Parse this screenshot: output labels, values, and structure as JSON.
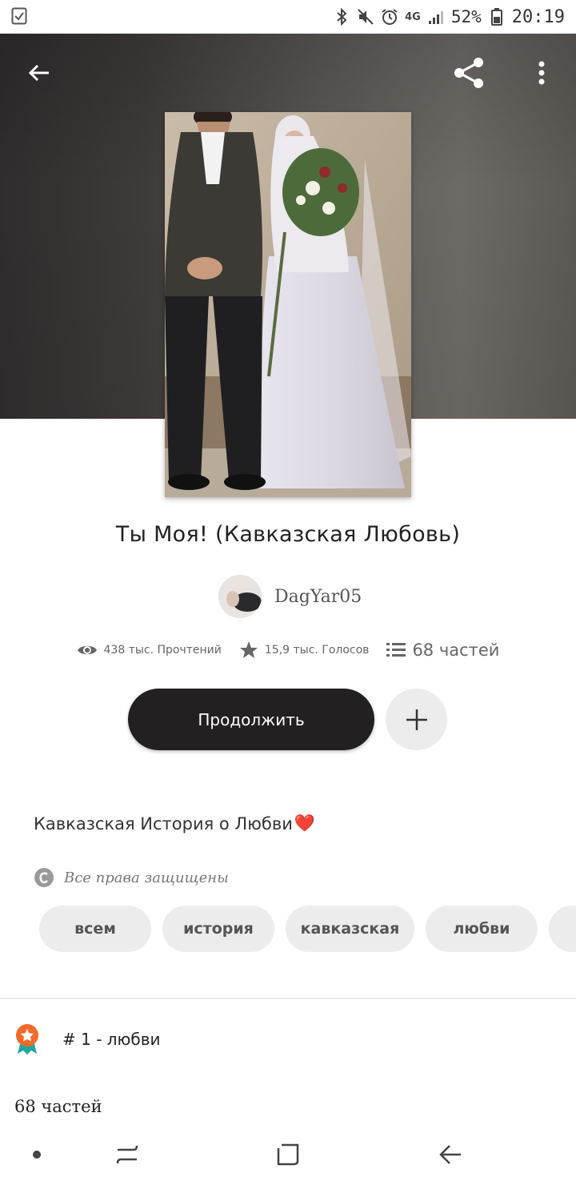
{
  "status_bar": {
    "network": "4G",
    "battery": "52%",
    "time": "20:19"
  },
  "story": {
    "title": "Ты Моя! (Кавказская Любовь)",
    "author": "DagYar05",
    "description": "Кавказская История о Любви",
    "description_emoji": "❤️",
    "rights": "Все права защищены"
  },
  "stats": {
    "reads": "438 тыс. Прочтений",
    "votes": "15,9 тыс. Голосов",
    "parts": "68 частей"
  },
  "actions": {
    "continue_label": "Продолжить"
  },
  "tags": [
    "всем",
    "история",
    "кавказская",
    "любви"
  ],
  "rank": {
    "text": "# 1 - любви"
  },
  "parts_label": "68 частей",
  "colors": {
    "primary_button": "#222021",
    "chip_bg": "#ececec",
    "rank_badge": "#f26b2a"
  }
}
